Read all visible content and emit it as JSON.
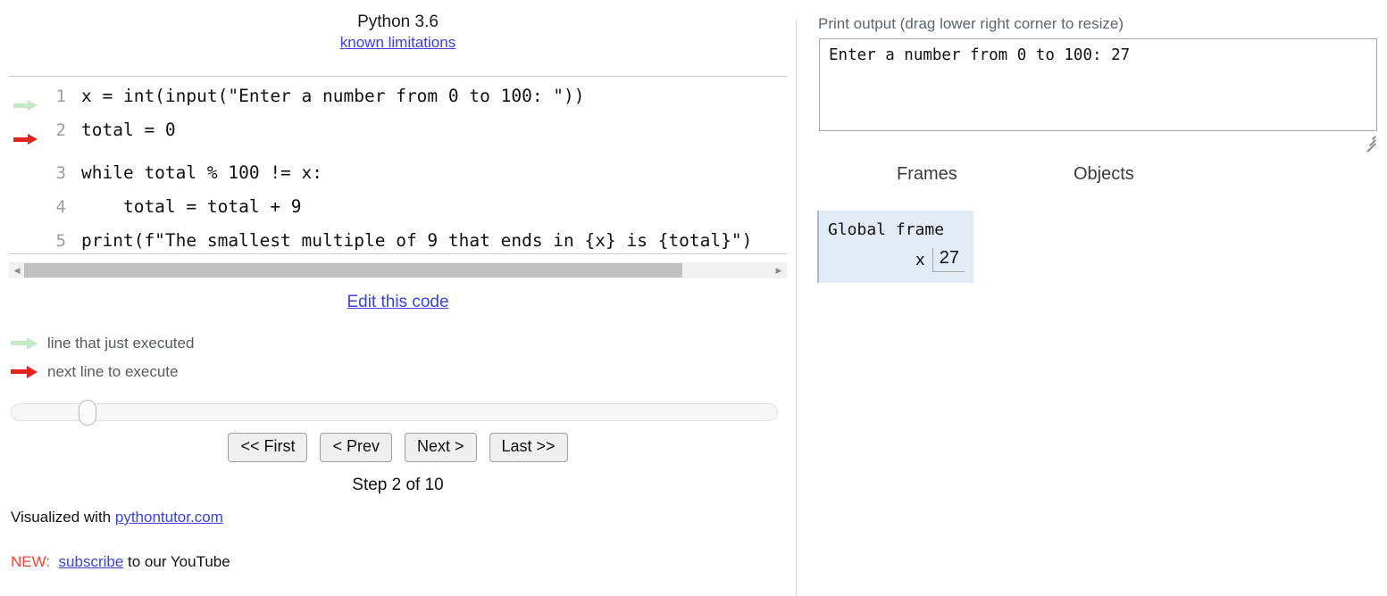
{
  "left": {
    "title": "Python 3.6",
    "limitations_link": "known limitations",
    "code_lines": [
      {
        "num": "1",
        "text": "x = int(input(\"Enter a number from 0 to 100: \"))",
        "marker": "green-arrow"
      },
      {
        "num": "2",
        "text": "total = 0",
        "marker": "red-arrow"
      },
      {
        "num": "3",
        "text": "while total % 100 != x:",
        "marker": "none"
      },
      {
        "num": "4",
        "text": "    total = total + 9",
        "marker": "none"
      },
      {
        "num": "5",
        "text": "print(f\"The smallest multiple of 9 that ends in {x} is {total}\")",
        "marker": "none"
      }
    ],
    "edit_link": "Edit this code",
    "legend": [
      {
        "label": "line that just executed",
        "color": "#c5e8c5"
      },
      {
        "label": "next line to execute",
        "color": "#e4231f"
      }
    ],
    "slider": {
      "value_percent": 9
    },
    "nav_buttons": [
      {
        "label": "<< First"
      },
      {
        "label": "< Prev"
      },
      {
        "label": "Next >"
      },
      {
        "label": "Last >>"
      }
    ],
    "step_label": "Step 2 of 10",
    "footer": {
      "visualized_prefix": "Visualized with ",
      "visualized_link": "pythontutor.com",
      "new_tag": "NEW:",
      "subscribe_link": "subscribe",
      "subscribe_suffix": " to our YouTube"
    },
    "scrollbar": {
      "left_arrow": "◀",
      "right_arrow": "▶"
    }
  },
  "right": {
    "print_output_label": "Print output (drag lower right corner to resize)",
    "print_output_value": "Enter a number from 0 to 100: 27",
    "columns": {
      "frames": "Frames",
      "objects": "Objects"
    },
    "frames": [
      {
        "title": "Global frame",
        "variables": [
          {
            "name": "x",
            "value": "27"
          }
        ]
      }
    ]
  },
  "colors": {
    "link": "#3c44d8",
    "green_arrow": "#c5e8c5",
    "red_arrow": "#e4231f",
    "frame_bg": "#e2ebf6",
    "new_tag": "#e8493c",
    "label_gray": "#5c6670"
  }
}
